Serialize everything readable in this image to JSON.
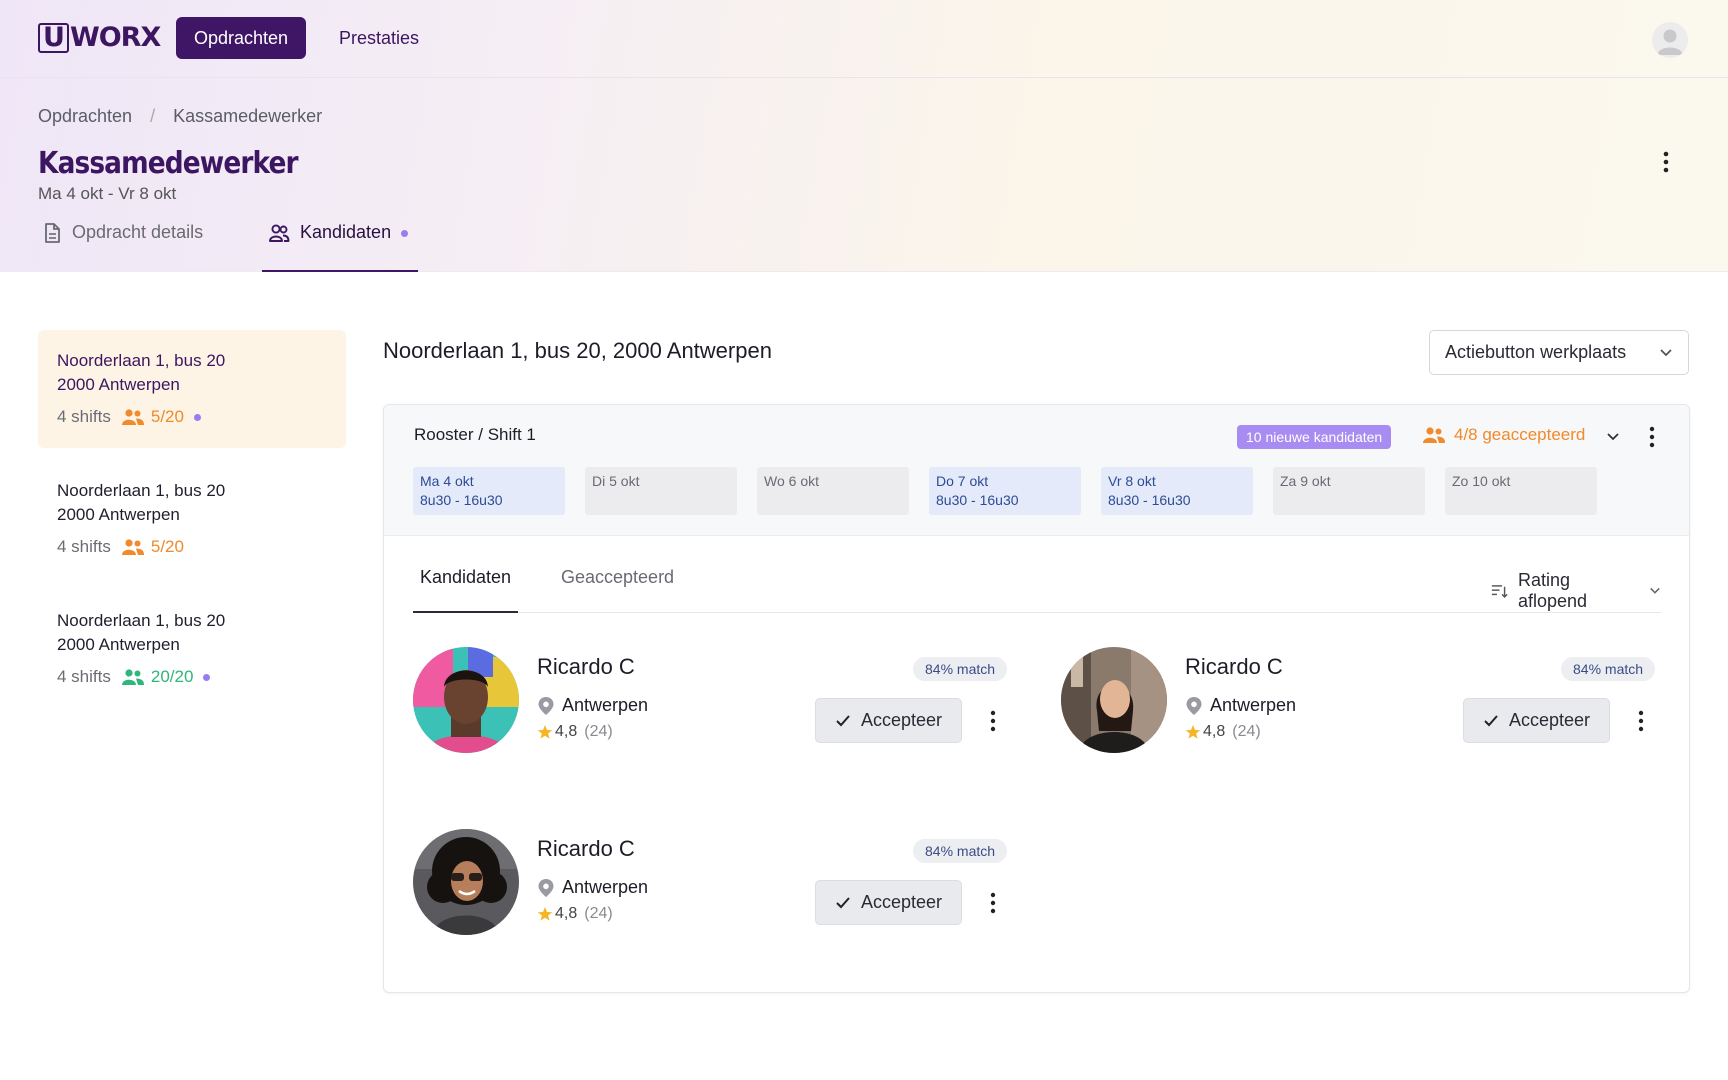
{
  "header": {
    "logo_u": "U",
    "logo_rest": "WORX",
    "nav": [
      {
        "label": "Opdrachten"
      },
      {
        "label": "Prestaties"
      }
    ]
  },
  "breadcrumb": [
    "Opdrachten",
    "/",
    "Kassamedewerker"
  ],
  "page": {
    "title": "Kassamedewerker",
    "subtitle": "Ma 4 okt - Vr 8 okt",
    "tabs": [
      {
        "label": "Opdracht details"
      },
      {
        "label": "Kandidaten"
      }
    ]
  },
  "locations": [
    {
      "line1": "Noorderlaan 1, bus 20",
      "line2": "2000 Antwerpen",
      "shifts": "4 shifts",
      "count": "5/20",
      "status": "orange"
    },
    {
      "line1": "Noorderlaan 1, bus 20",
      "line2": "2000 Antwerpen",
      "shifts": "4 shifts",
      "count": "5/20",
      "status": "orange"
    },
    {
      "line1": "Noorderlaan 1, bus 20",
      "line2": "2000 Antwerpen",
      "shifts": "4 shifts",
      "count": "20/20",
      "status": "green"
    }
  ],
  "main": {
    "title": "Noorderlaan 1, bus 20, 2000 Antwerpen",
    "action_dropdown": "Actiebutton werkplaats"
  },
  "shift": {
    "title": "Rooster / Shift 1",
    "new_badge": "10 nieuwe kandidaten",
    "accepted": "4/8 geaccepteerd",
    "days": [
      {
        "day": "Ma 4 okt",
        "time": "8u30 - 16u30"
      },
      {
        "day": "Di 5 okt",
        "time": ""
      },
      {
        "day": "Wo 6 okt",
        "time": ""
      },
      {
        "day": "Do 7 okt",
        "time": "8u30 - 16u30"
      },
      {
        "day": "Vr 8 okt",
        "time": "8u30 - 16u30"
      },
      {
        "day": "Za 9 okt",
        "time": ""
      },
      {
        "day": "Zo 10 okt",
        "time": ""
      }
    ]
  },
  "candidate_tabs": [
    {
      "label": "Kandidaten"
    },
    {
      "label": "Geaccepteerd"
    }
  ],
  "sort_label": "Rating aflopend",
  "candidates": [
    {
      "name": "Ricardo C",
      "city": "Antwerpen",
      "rating": "4,8",
      "reviews": "(24)",
      "match": "84% match",
      "accept": "Accepteer"
    },
    {
      "name": "Ricardo C",
      "city": "Antwerpen",
      "rating": "4,8",
      "reviews": "(24)",
      "match": "84% match",
      "accept": "Accepteer"
    },
    {
      "name": "Ricardo C",
      "city": "Antwerpen",
      "rating": "4,8",
      "reviews": "(24)",
      "match": "84% match",
      "accept": "Accepteer"
    }
  ],
  "colors": {
    "brand": "#3f1666",
    "accent_orange": "#f08a2a",
    "accent_green": "#2fb67a",
    "badge_purple": "#a98cf2"
  },
  "icons": [
    "document-icon",
    "users-icon",
    "chevron-down-icon",
    "more-vertical-icon",
    "location-pin-icon",
    "star-icon",
    "check-icon",
    "sort-icon",
    "user-avatar-icon"
  ]
}
